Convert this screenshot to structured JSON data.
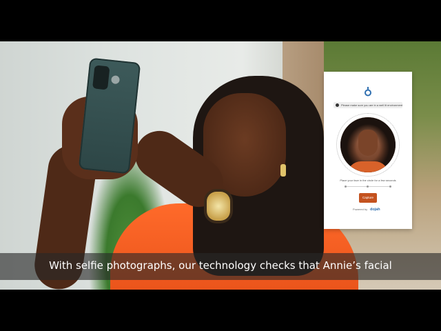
{
  "verification_panel": {
    "notice": "Please make sure you are in a well lit environment",
    "instruction": "Place your face in the circle for a few seconds",
    "capture_label": "Capture",
    "powered_by_label": "Powered by",
    "powered_by_brand": "dojah",
    "accent_color": "#c4521f",
    "brand_color": "#2f6fb0"
  },
  "caption": {
    "text": "With selfie photographs, our technology checks that Annie’s facial"
  }
}
